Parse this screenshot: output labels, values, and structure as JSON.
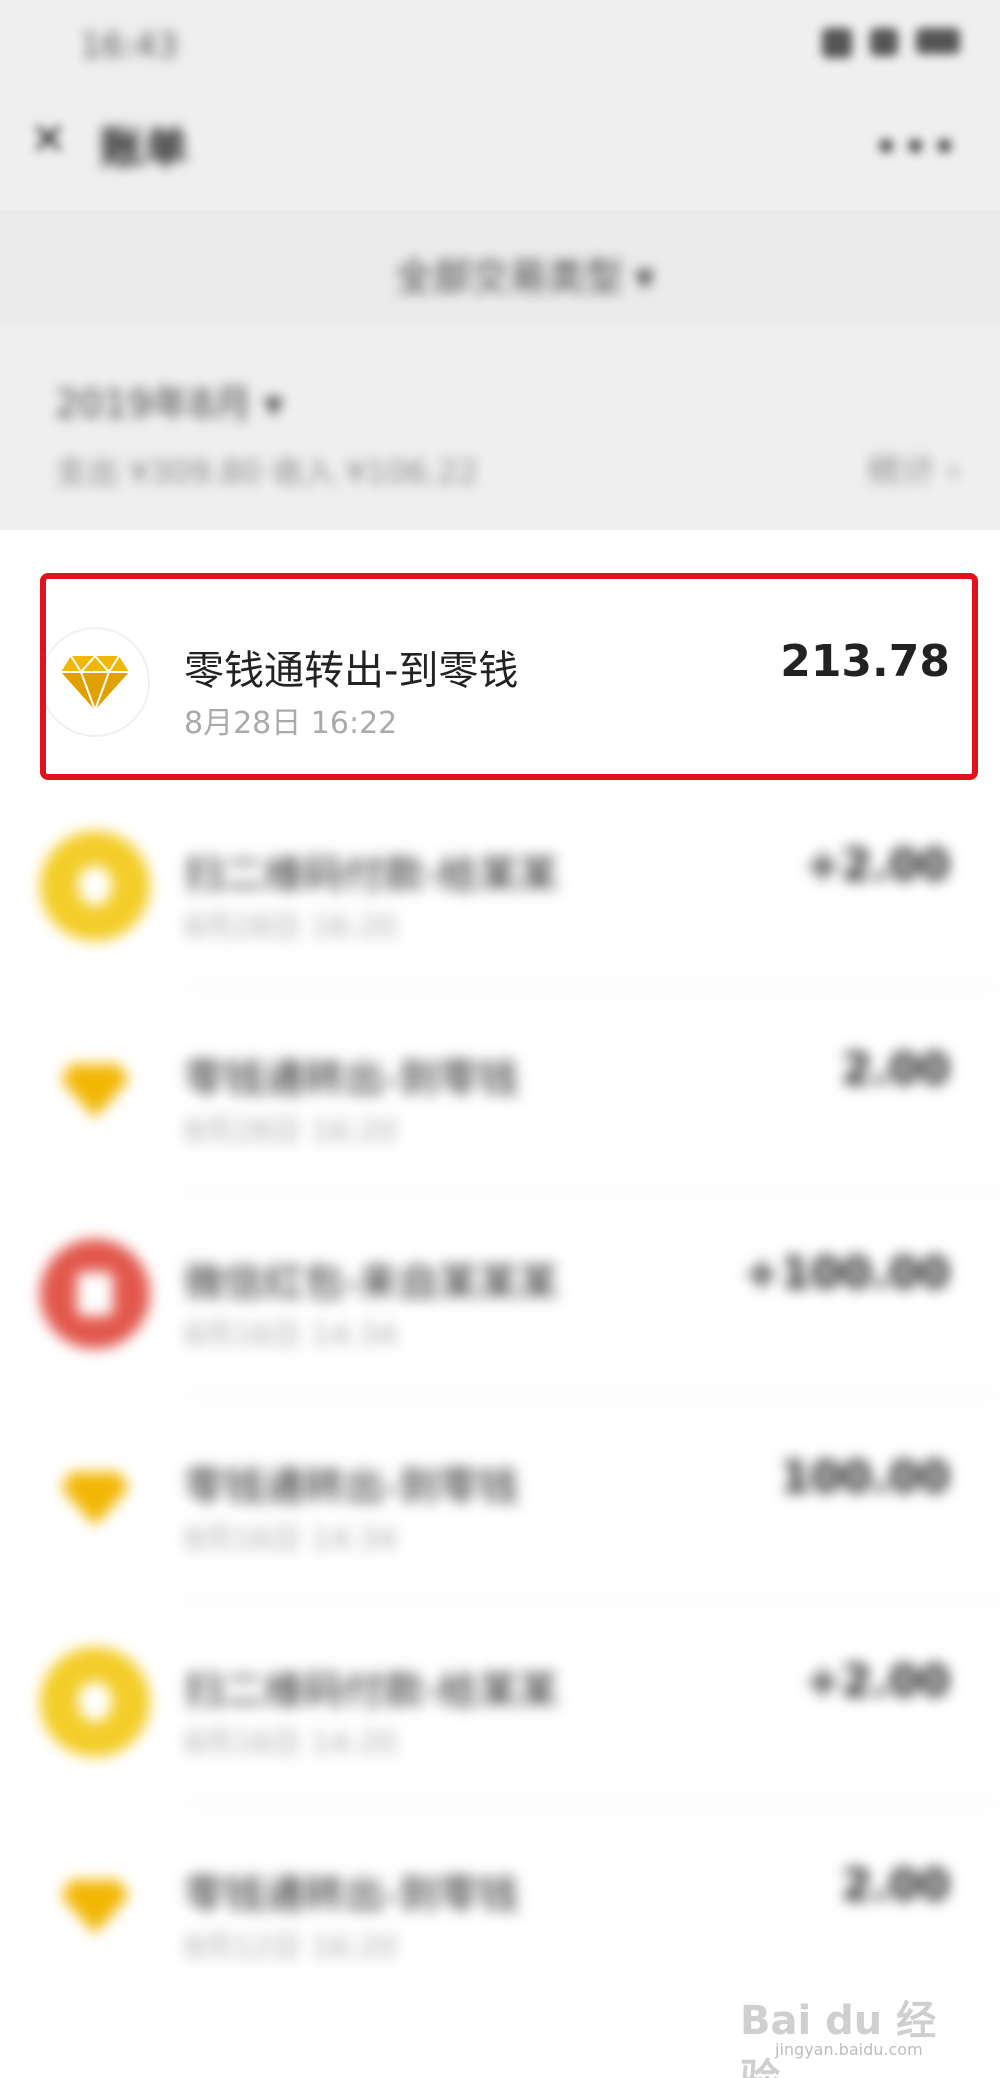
{
  "status_bar": {
    "time": "16:43"
  },
  "header": {
    "title": "账单",
    "close_icon": "close-icon",
    "more_icon": "more-icon"
  },
  "filter": {
    "label": "全部交易类型 ▾"
  },
  "month": {
    "title": "2019年8月 ▾",
    "summary": "支出 ¥309.80 收入 ¥106.22",
    "stats_link": "统计 ›"
  },
  "transactions": [
    {
      "title": "零钱通转出-到零钱",
      "date": "8月28日 16:22",
      "amount": "213.78",
      "icon": "diamond-icon",
      "highlighted": true
    },
    {
      "title": "扫二维码付款-给某某",
      "date": "8月28日 16:20",
      "amount": "+2.00",
      "icon": "coin-icon"
    },
    {
      "title": "零钱通转出-到零钱",
      "date": "8月28日 16:20",
      "amount": "2.00",
      "icon": "diamond-icon"
    },
    {
      "title": "微信红包-来自某某某",
      "date": "8月16日 14:34",
      "amount": "+100.00",
      "icon": "red-packet-icon"
    },
    {
      "title": "零钱通转出-到零钱",
      "date": "8月16日 14:34",
      "amount": "100.00",
      "icon": "diamond-icon"
    },
    {
      "title": "扫二维码付款-给某某",
      "date": "8月16日 14:20",
      "amount": "+2.00",
      "icon": "coin-icon"
    },
    {
      "title": "零钱通转出-到零钱",
      "date": "8月12日 16:20",
      "amount": "2.00",
      "icon": "diamond-icon"
    }
  ],
  "watermark": {
    "text": "Bai du 经验",
    "sub": "jingyan.baidu.com"
  },
  "colors": {
    "highlight_border": "#e0121b",
    "diamond": "#f2b705",
    "coin": "#f3cd28",
    "red_packet": "#e2574c"
  }
}
